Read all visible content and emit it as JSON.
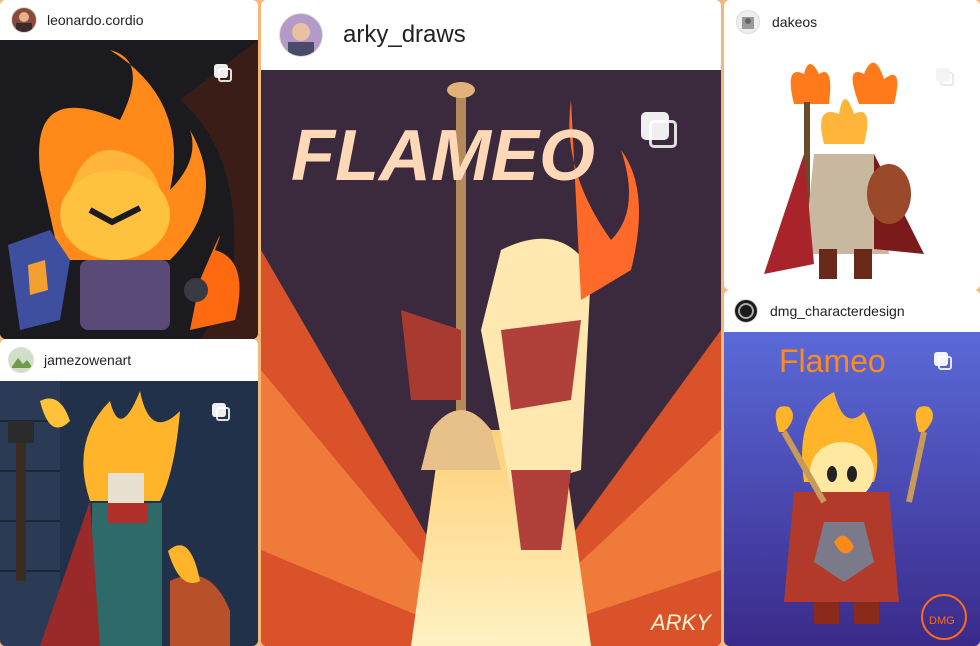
{
  "posts": [
    {
      "username": "leonardo.cordio",
      "avatar_icon": "user-avatar-icon",
      "media_icon": "multiple-images-icon"
    },
    {
      "username": "arky_draws",
      "avatar_icon": "user-avatar-icon",
      "media_icon": "multiple-images-icon",
      "title_art": "FLAMEO",
      "signature": "ARKY"
    },
    {
      "username": "dakeos",
      "avatar_icon": "user-avatar-icon",
      "media_icon": "multiple-images-icon"
    },
    {
      "username": "jamezowenart",
      "avatar_icon": "user-avatar-icon",
      "media_icon": "multiple-images-icon"
    },
    {
      "username": "dmg_characterdesign",
      "avatar_icon": "user-avatar-icon",
      "media_icon": "multiple-images-icon",
      "title_art": "Flameo",
      "logo": "DMG"
    }
  ],
  "colors": {
    "background": "#f3b778",
    "flame": "#ff8a1a",
    "dark_bg": "#1b1a1f",
    "purple_bg": "#3b2a3d",
    "blue_bg": "#4b56c6"
  }
}
